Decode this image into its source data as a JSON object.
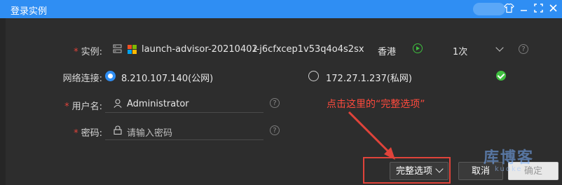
{
  "window": {
    "title": "登录实例",
    "titlebar_icons": [
      "shirt-icon",
      "minimize-icon",
      "maximize-icon",
      "close-icon"
    ]
  },
  "form": {
    "instance": {
      "label": "实例:",
      "name": "launch-advisor-20210402",
      "id": "i-j6cfxcep1v53q4o4s2sx",
      "region": "香港",
      "count": "1次"
    },
    "network": {
      "label": "网络连接:",
      "public_ip": "8.210.107.140(公网)",
      "private_ip": "172.27.1.237(私网)",
      "selected": "public"
    },
    "username": {
      "label": "用户名:",
      "value": "Administrator"
    },
    "password": {
      "label": "密码:",
      "placeholder": "请输入密码"
    }
  },
  "annotation": {
    "text": "点击这里的“完整选项”"
  },
  "buttons": {
    "more_options": "完整选项",
    "cancel": "取消",
    "confirm": "确定"
  },
  "watermark": {
    "text": "库博客",
    "sub": "kuoke"
  },
  "colors": {
    "accent": "#2f8ef3",
    "required": "#e0433a",
    "annotation": "#ff4a3d",
    "success": "#3fbf3f"
  }
}
